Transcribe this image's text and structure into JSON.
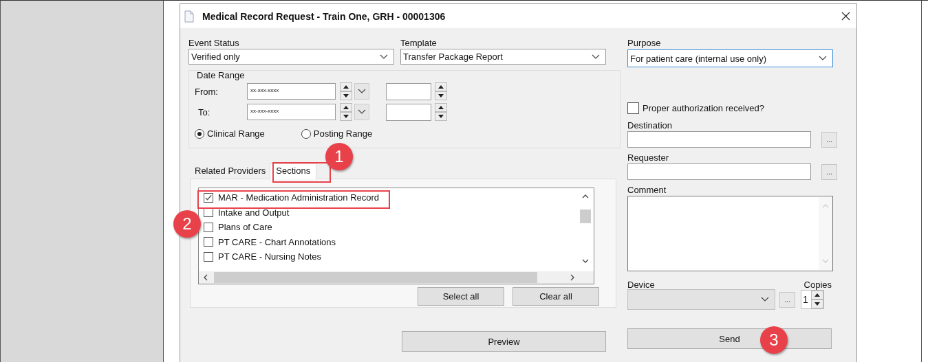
{
  "window": {
    "title": "Medical Record Request - Train One, GRH - 00001306"
  },
  "event_status": {
    "label": "Event Status",
    "value": "Verified only"
  },
  "template": {
    "label": "Template",
    "value": "Transfer Package Report"
  },
  "date_range": {
    "title": "Date Range",
    "rows": [
      {
        "label": "From:",
        "value": "xx-xxx-xxxx"
      },
      {
        "label": "To:",
        "value": "xx-xxx-xxxx"
      }
    ],
    "options": [
      {
        "label": "Clinical Range",
        "selected": true
      },
      {
        "label": "Posting Range",
        "selected": false
      }
    ]
  },
  "tabs": [
    {
      "label": "Related Providers",
      "selected": false
    },
    {
      "label": "Sections",
      "selected": true
    }
  ],
  "sections": [
    {
      "label": "MAR - Medication Administration Record",
      "checked": true
    },
    {
      "label": "Intake and Output",
      "checked": false
    },
    {
      "label": "Plans of Care",
      "checked": false
    },
    {
      "label": "PT CARE - Chart Annotations",
      "checked": false
    },
    {
      "label": "PT CARE - Nursing Notes",
      "checked": false
    }
  ],
  "list_buttons": [
    "Select all",
    "Clear all"
  ],
  "preview_button": "Preview",
  "purpose": {
    "label": "Purpose",
    "value": "For patient care (internal use only)"
  },
  "authorization": {
    "label": "Proper authorization received?",
    "checked": false
  },
  "destination": {
    "label": "Destination",
    "button": "..."
  },
  "requester": {
    "label": "Requester",
    "button": "..."
  },
  "comment": {
    "label": "Comment"
  },
  "device": {
    "label": "Device",
    "button": "...",
    "disabled": true
  },
  "copies": {
    "label": "Copies",
    "value": "1"
  },
  "send_button": "Send",
  "callouts": [
    "1",
    "2",
    "3"
  ]
}
